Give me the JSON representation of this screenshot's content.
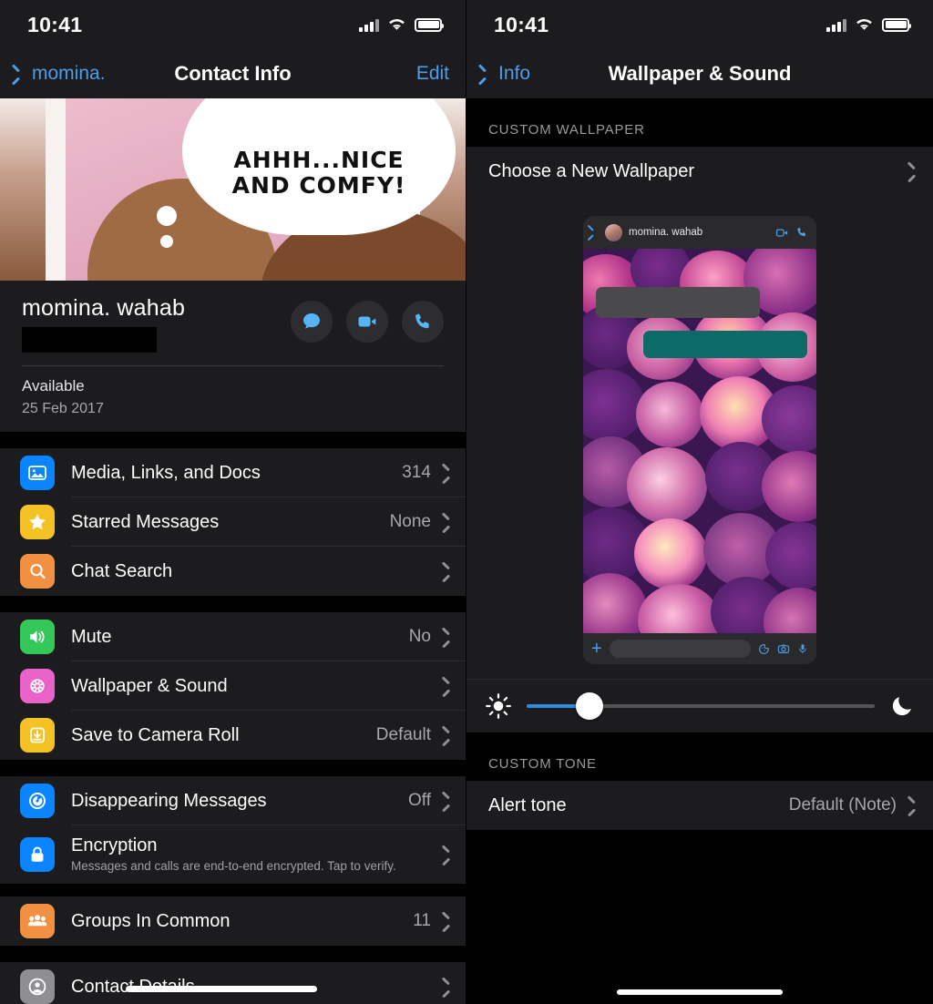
{
  "status_bar": {
    "time": "10:41",
    "signal_icon": "cellular-bars-icon",
    "wifi_icon": "wifi-icon",
    "battery_icon": "battery-icon"
  },
  "left_screen": {
    "nav": {
      "back_label": "momina.",
      "title": "Contact Info",
      "edit_label": "Edit"
    },
    "cover_photo": {
      "speech_line1": "AHHH...NICE",
      "speech_line2": "AND COMFY!"
    },
    "profile": {
      "name": "momina. wahab",
      "phone_redacted": "",
      "status": "Available",
      "status_date": "25 Feb 2017",
      "actions": [
        {
          "name": "message-button",
          "icon": "chat-bubble-icon"
        },
        {
          "name": "video-call-button",
          "icon": "video-camera-icon"
        },
        {
          "name": "voice-call-button",
          "icon": "phone-icon"
        }
      ]
    },
    "groups": [
      {
        "rows": [
          {
            "label": "Media, Links, and Docs",
            "value": "314",
            "icon": "photo-icon",
            "color": "#0a84ff"
          },
          {
            "label": "Starred Messages",
            "value": "None",
            "icon": "star-icon",
            "color": "#f5c226"
          },
          {
            "label": "Chat Search",
            "value": "",
            "icon": "search-icon",
            "color": "#f09040"
          }
        ]
      },
      {
        "rows": [
          {
            "label": "Mute",
            "value": "No",
            "icon": "speaker-icon",
            "color": "#34c759"
          },
          {
            "label": "Wallpaper & Sound",
            "value": "",
            "icon": "flower-icon",
            "color": "#e862c8"
          },
          {
            "label": "Save to Camera Roll",
            "value": "Default",
            "icon": "download-icon",
            "color": "#f5c226"
          }
        ]
      },
      {
        "rows": [
          {
            "label": "Disappearing Messages",
            "value": "Off",
            "icon": "timer-icon",
            "color": "#0a84ff",
            "subtitle": ""
          },
          {
            "label": "Encryption",
            "value": "",
            "icon": "lock-icon",
            "color": "#0a84ff",
            "subtitle": "Messages and calls are end-to-end encrypted. Tap to verify."
          }
        ]
      },
      {
        "rows": [
          {
            "label": "Groups In Common",
            "value": "11",
            "icon": "people-icon",
            "color": "#f09040"
          }
        ]
      },
      {
        "rows": [
          {
            "label": "Contact Details",
            "value": "",
            "icon": "contact-card-icon",
            "color": "#8e8e93"
          }
        ]
      }
    ]
  },
  "right_screen": {
    "nav": {
      "back_label": "Info",
      "title": "Wallpaper & Sound"
    },
    "wallpaper_section": {
      "header": "CUSTOM WALLPAPER",
      "choose_label": "Choose a New Wallpaper"
    },
    "preview": {
      "contact_name": "momina. wahab",
      "back_icon": "chevron-left-icon",
      "avatar_icon": "avatar",
      "video_icon": "video-camera-icon",
      "call_icon": "phone-icon",
      "composer": {
        "plus_icon": "plus-icon",
        "sticker_icon": "sticker-icon",
        "camera_icon": "camera-icon",
        "mic_icon": "microphone-icon",
        "placeholder": ""
      }
    },
    "brightness": {
      "sun_icon": "sun-icon",
      "moon_icon": "moon-icon",
      "value": 18
    },
    "tone_section": {
      "header": "CUSTOM TONE",
      "alert_label": "Alert tone",
      "alert_value": "Default (Note)"
    }
  }
}
